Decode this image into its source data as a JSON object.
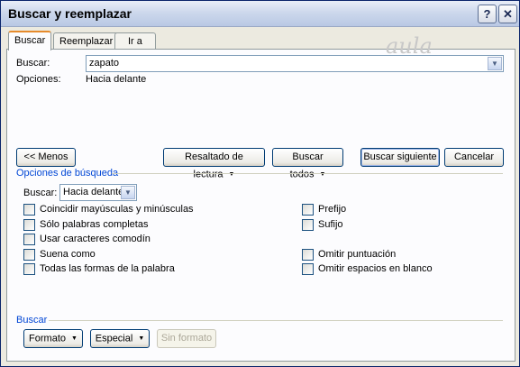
{
  "window": {
    "title": "Buscar y reemplazar",
    "help_label": "?",
    "close_label": "✕"
  },
  "tabs": [
    {
      "label": "Buscar",
      "active": true
    },
    {
      "label": "Reemplazar",
      "active": false
    },
    {
      "label": "Ir a",
      "active": false
    }
  ],
  "watermark": "aula",
  "search": {
    "label": "Buscar:",
    "value": "zapato"
  },
  "options": {
    "label": "Opciones:",
    "value": "Hacia delante"
  },
  "buttons": {
    "less": "<< Menos",
    "reading_highlight": "Resaltado de lectura",
    "find_all": "Buscar todos",
    "find_next": "Buscar siguiente",
    "cancel": "Cancelar",
    "format": "Formato",
    "special": "Especial",
    "no_format": "Sin formato"
  },
  "search_options": {
    "group_label": "Opciones de búsqueda",
    "direction_label": "Buscar:",
    "direction_value": "Hacia delante",
    "left": [
      {
        "label": "Coincidir mayúsculas y minúsculas",
        "checked": false
      },
      {
        "label": "Sólo palabras completas",
        "checked": false
      },
      {
        "label": "Usar caracteres comodín",
        "checked": false
      },
      {
        "label": "Suena como",
        "checked": false
      },
      {
        "label": "Todas las formas de la palabra",
        "checked": false
      }
    ],
    "right": [
      {
        "label": "Prefijo",
        "checked": false
      },
      {
        "label": "Sufijo",
        "checked": false
      },
      {
        "label": "Omitir puntuación",
        "checked": false
      },
      {
        "label": "Omitir espacios en blanco",
        "checked": false
      }
    ]
  },
  "find_group": {
    "label": "Buscar"
  },
  "icons": {
    "dropdown": "chevron-down-icon",
    "close": "close-icon",
    "help": "help-icon"
  },
  "colors": {
    "title_bar": "#cdd8ec",
    "group_label": "#0046d5",
    "dialog_bg": "#eceae0"
  }
}
